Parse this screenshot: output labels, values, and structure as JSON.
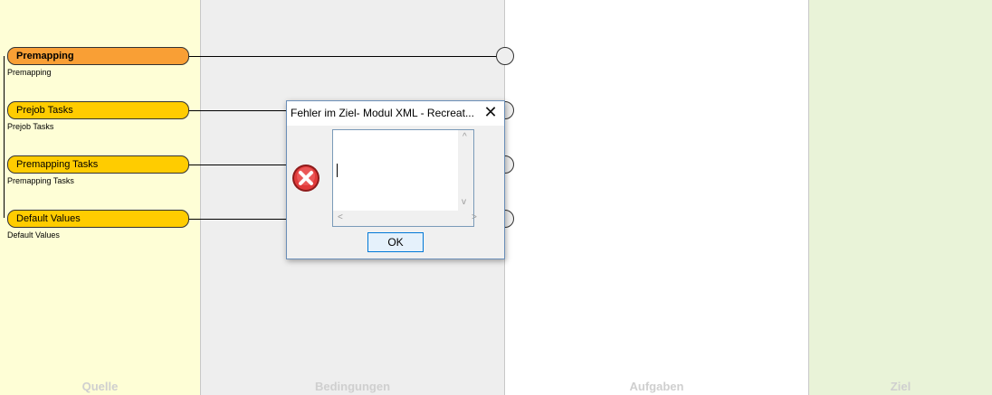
{
  "lanes": [
    {
      "label": "Quelle"
    },
    {
      "label": "Bedingungen"
    },
    {
      "label": "Aufgaben"
    },
    {
      "label": "Ziel"
    }
  ],
  "nodes": [
    {
      "label": "Premapping",
      "sub": "Premapping"
    },
    {
      "label": "Prejob Tasks",
      "sub": "Prejob Tasks"
    },
    {
      "label": "Premapping Tasks",
      "sub": "Premapping Tasks"
    },
    {
      "label": "Default Values",
      "sub": "Default Values"
    }
  ],
  "dialog": {
    "title": "Fehler im Ziel- Modul XML - Recreat...",
    "close_glyph": "✕",
    "message_lines": [
      "",
      "------------------------------",
      "null",
      "------------------------------",
      "null"
    ],
    "ok_label": "OK",
    "icon": "error-icon"
  },
  "colors": {
    "node_primary": "#f99f35",
    "node_secondary": "#ffcc00",
    "lane_quelle": "#fefed6",
    "lane_bedingungen": "#eeeeee",
    "lane_ziel": "#e9f3d8"
  }
}
